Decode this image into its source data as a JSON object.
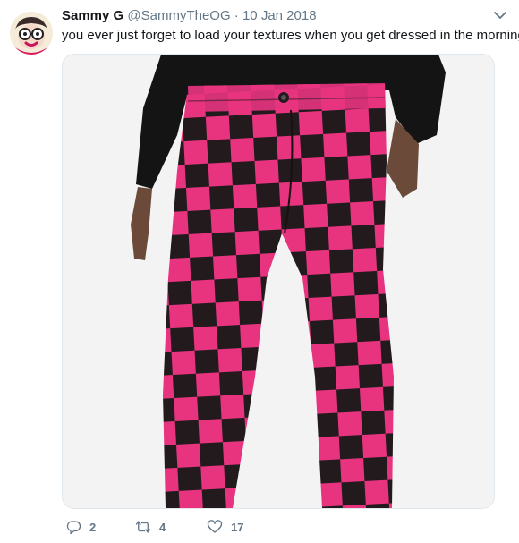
{
  "tweet": {
    "author_name": "Sammy G",
    "handle": "@SammyTheOG",
    "separator": "·",
    "date": "10 Jan 2018",
    "text": "you ever just forget to load your textures when you get dressed in the morning"
  },
  "actions": {
    "reply_count": "2",
    "retweet_count": "4",
    "like_count": "17"
  },
  "icons": {
    "avatar": "cartoon-avatar-icon",
    "menu": "chevron-down-icon",
    "reply": "reply-icon",
    "retweet": "retweet-icon",
    "like": "heart-icon"
  },
  "colors": {
    "pant_pink": "#e8347f",
    "pant_black": "#231a1e",
    "sweater": "#141414",
    "secondary_text": "#657786"
  }
}
